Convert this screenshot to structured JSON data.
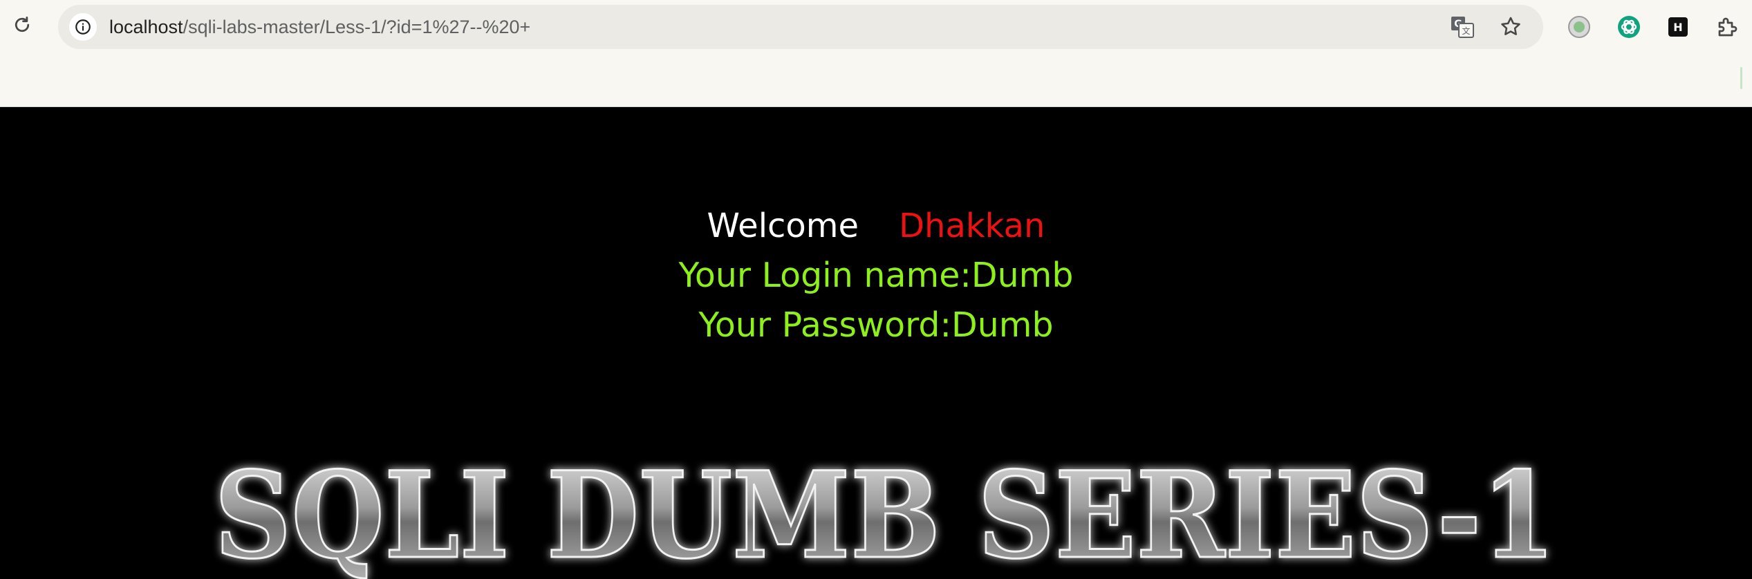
{
  "browser": {
    "url_host": "localhost",
    "url_path": "/sqli-labs-master/Less-1/?id=1%27--%20+",
    "icons": {
      "reload": "reload-icon",
      "site_info": "info-icon",
      "translate": "translate-icon",
      "bookmark": "star-icon",
      "extension_1": "circle-extension-icon",
      "extension_2": "chatgpt-icon",
      "extension_3": "h-extension-icon",
      "extensions_menu": "puzzle-icon"
    }
  },
  "page": {
    "welcome_word": "Welcome",
    "welcome_name": "Dhakkan",
    "login_line": "Your Login name:Dumb",
    "password_line": "Your Password:Dumb",
    "banner_text": "SQLI DUMB SERIES-1",
    "colors": {
      "background": "#000000",
      "welcome": "#ffffff",
      "name": "#ee1111",
      "credentials": "#8ef01a"
    }
  }
}
